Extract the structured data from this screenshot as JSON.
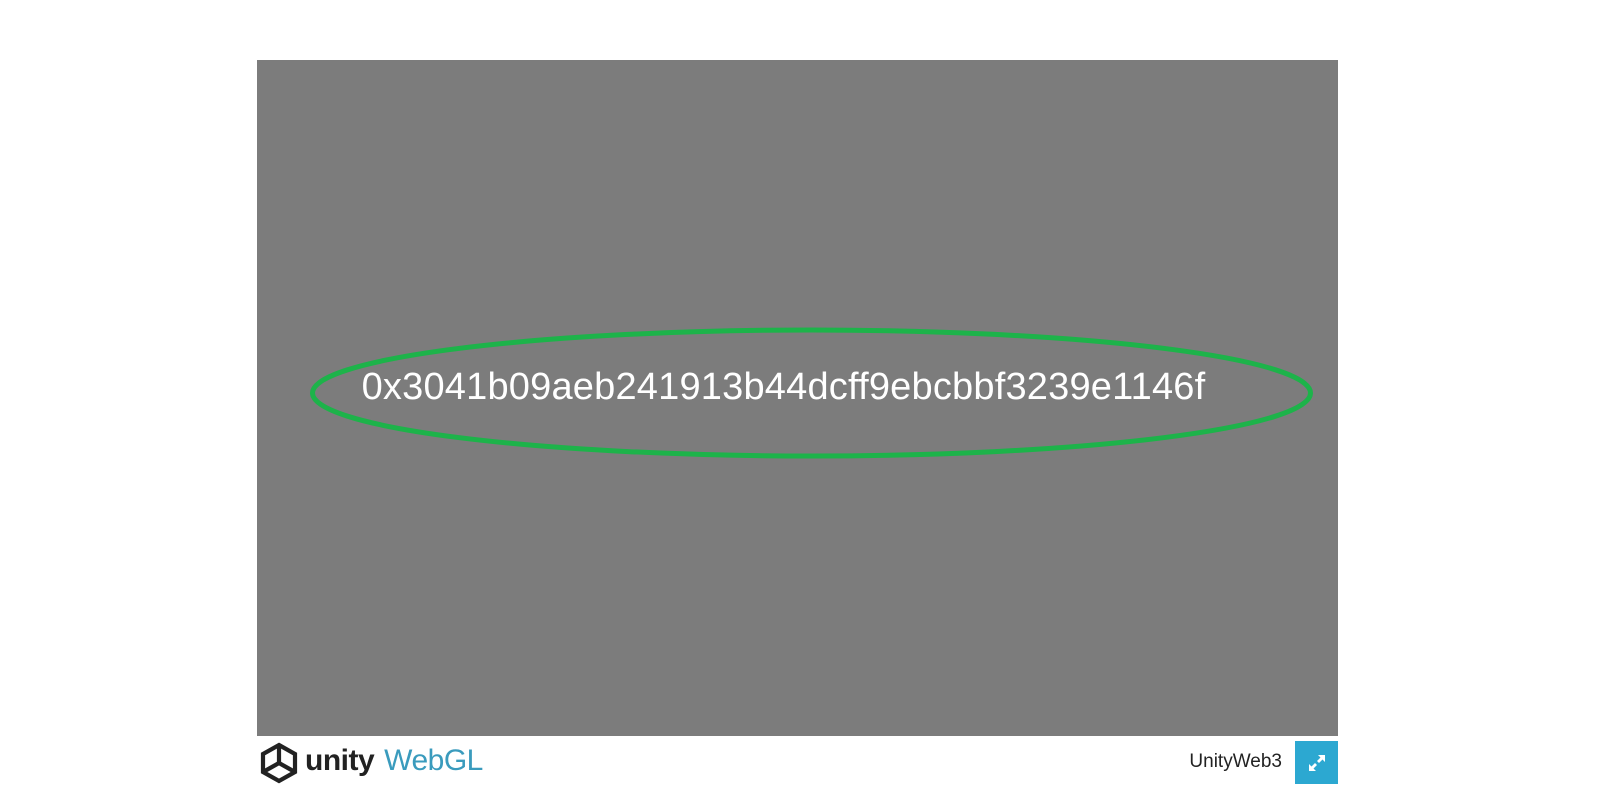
{
  "game": {
    "address_text": "0x3041b09aeb241913b44dcff9ebcbbf3239e1146f",
    "canvas_color": "#7c7c7c",
    "highlight_color": "#1db34a"
  },
  "footer": {
    "logo_unity": "unity",
    "logo_webgl": "WebGL",
    "title": "UnityWeb3",
    "fullscreen_icon": "fullscreen-icon",
    "fullscreen_color": "#2ca8d1",
    "webgl_color": "#3a9bbd"
  }
}
